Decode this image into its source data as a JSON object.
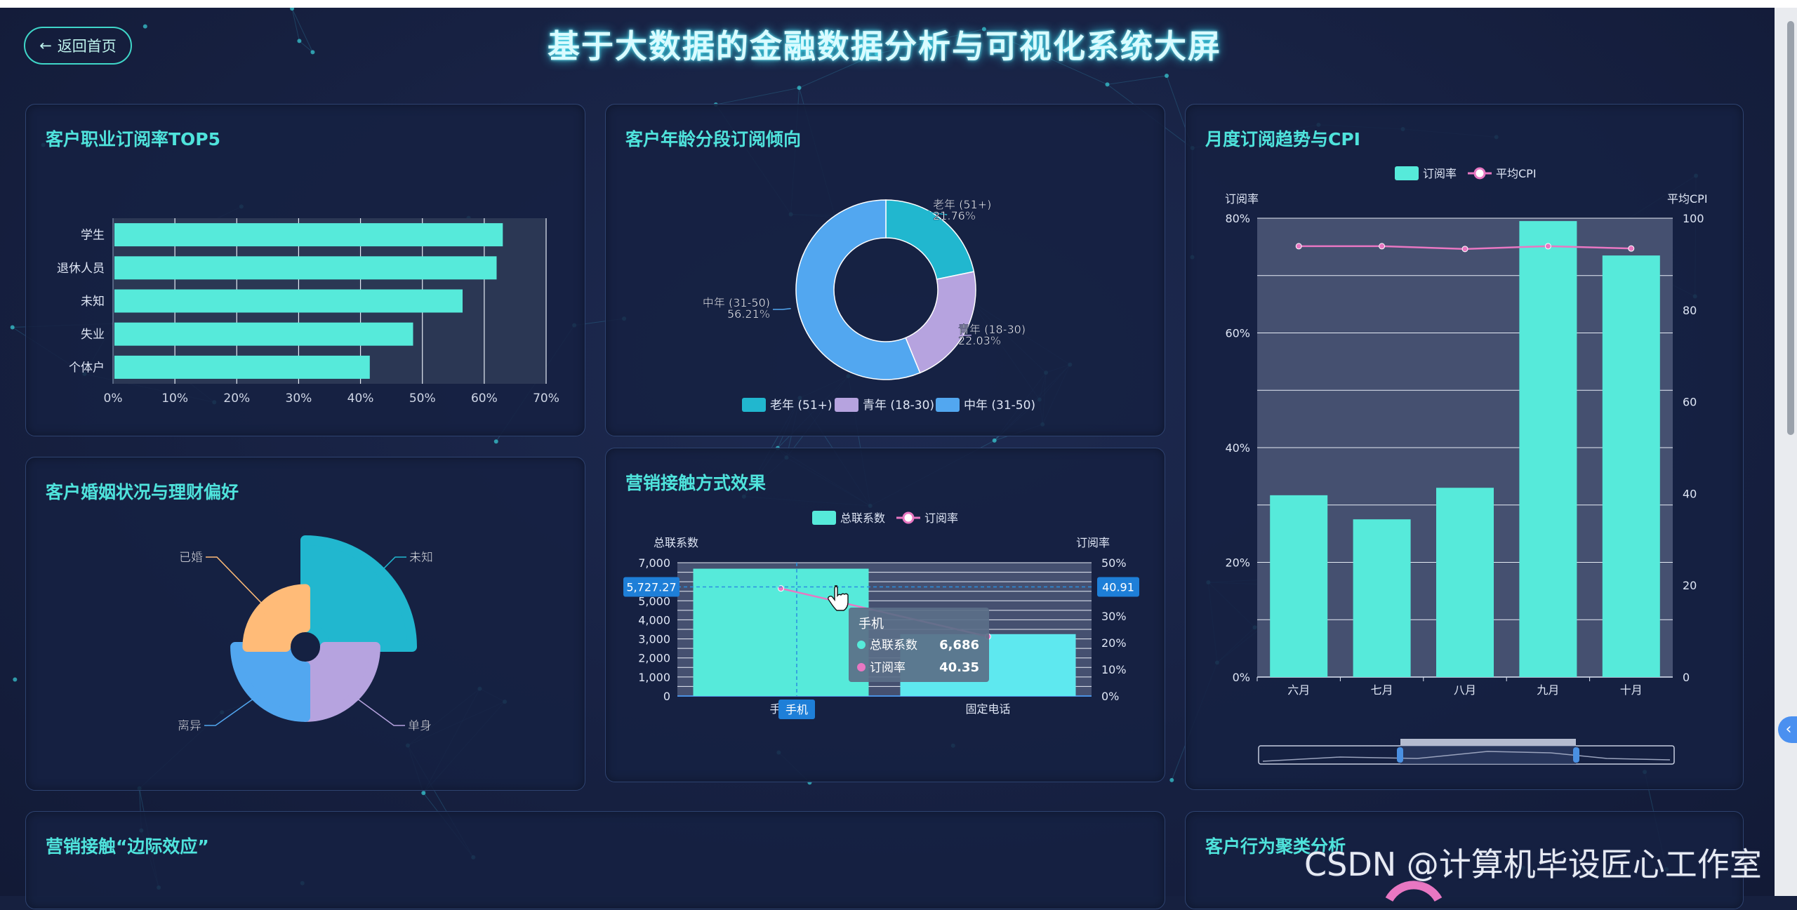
{
  "header": {
    "back_label": "返回首页",
    "title": "基于大数据的金融数据分析与可视化系统大屏"
  },
  "panels": {
    "occupation": {
      "title": "客户职业订阅率TOP5"
    },
    "age": {
      "title": "客户年龄分段订阅倾向"
    },
    "monthly": {
      "title": "月度订阅趋势与CPI"
    },
    "marital": {
      "title": "客户婚姻状况与理财偏好"
    },
    "contact": {
      "title": "营销接触方式效果"
    },
    "marginal": {
      "title": "营销接触“边际效应”"
    },
    "cluster": {
      "title": "客户行为聚类分析"
    }
  },
  "watermark": "CSDN @计算机毕设匠心工作室",
  "colors": {
    "teal": "#56eada",
    "cyan": "#21b7cf",
    "lavender": "#b6a3df",
    "blue": "#52a7f0",
    "orange": "#ffbb78",
    "pink": "#e877c2",
    "accent_title": "#4fe3dc"
  },
  "icons": {
    "back": "arrow-left-icon",
    "side_toggle": "chevron-left-icon",
    "cursor": "hand-pointer-icon"
  },
  "chart_data": [
    {
      "id": "occupation",
      "type": "bar",
      "orientation": "horizontal",
      "categories": [
        "学生",
        "退休人员",
        "未知",
        "失业",
        "个体户"
      ],
      "values": [
        63,
        62,
        56.5,
        48.5,
        41.5
      ],
      "xticks": [
        "0%",
        "10%",
        "20%",
        "30%",
        "40%",
        "50%",
        "60%",
        "70%"
      ],
      "xlim": [
        0,
        70
      ],
      "grid": true
    },
    {
      "id": "age",
      "type": "pie",
      "donut": true,
      "slices": [
        {
          "name": "老年 (51+)",
          "value": 21.76,
          "label": "21.76%"
        },
        {
          "name": "青年 (18-30)",
          "value": 22.03,
          "label": "22.03%"
        },
        {
          "name": "中年 (31-50)",
          "value": 56.21,
          "label": "56.21%"
        }
      ],
      "legend": [
        "老年 (51+)",
        "青年 (18-30)",
        "中年 (31-50)"
      ],
      "legend_position": "bottom"
    },
    {
      "id": "monthly",
      "type": "bar",
      "categories": [
        "六月",
        "七月",
        "八月",
        "九月",
        "十月"
      ],
      "series": [
        {
          "name": "订阅率",
          "type": "bar",
          "values": [
            31.7,
            27.5,
            33,
            79.5,
            73.5
          ]
        },
        {
          "name": "平均CPI",
          "type": "line",
          "values": [
            93.9,
            93.9,
            93.3,
            93.9,
            93.4
          ]
        }
      ],
      "ylabel": "订阅率",
      "y2label": "平均CPI",
      "yticks": [
        "0%",
        "20%",
        "40%",
        "60%",
        "80%"
      ],
      "ylim": [
        0,
        80
      ],
      "y2ticks": [
        "0",
        "20",
        "40",
        "60",
        "80",
        "100"
      ],
      "y2lim": [
        0,
        100
      ],
      "legend": [
        "订阅率",
        "平均CPI"
      ],
      "legend_position": "top",
      "grid": true,
      "has_zoom_slider": true
    },
    {
      "id": "marital",
      "type": "pie",
      "rose": true,
      "slices": [
        {
          "name": "未知",
          "value": 100
        },
        {
          "name": "单身",
          "value": 58
        },
        {
          "name": "离异",
          "value": 58
        },
        {
          "name": "已婚",
          "value": 44
        }
      ]
    },
    {
      "id": "contact",
      "type": "bar",
      "categories": [
        "手机",
        "固定电话"
      ],
      "series": [
        {
          "name": "总联系数",
          "type": "bar",
          "values": [
            6686,
            3250
          ]
        },
        {
          "name": "订阅率",
          "type": "line",
          "values": [
            40.35,
            22.3
          ]
        }
      ],
      "ylabel": "总联系数",
      "y2label": "订阅率",
      "yticks": [
        "0",
        "1,000",
        "2,000",
        "3,000",
        "4,000",
        "5,000",
        "6,000",
        "7,000"
      ],
      "ylim": [
        0,
        7000
      ],
      "y2ticks": [
        "0%",
        "10%",
        "20%",
        "30%",
        "40%",
        "50%"
      ],
      "y2lim": [
        0,
        50
      ],
      "legend": [
        "总联系数",
        "订阅率"
      ],
      "legend_position": "top",
      "crosshair": {
        "y_left": "5,727.27",
        "y_right": "40.91",
        "x": "手机"
      },
      "tooltip": {
        "title": "手机",
        "rows": [
          {
            "name": "总联系数",
            "value": "6,686"
          },
          {
            "name": "订阅率",
            "value": "40.35"
          }
        ]
      }
    }
  ]
}
